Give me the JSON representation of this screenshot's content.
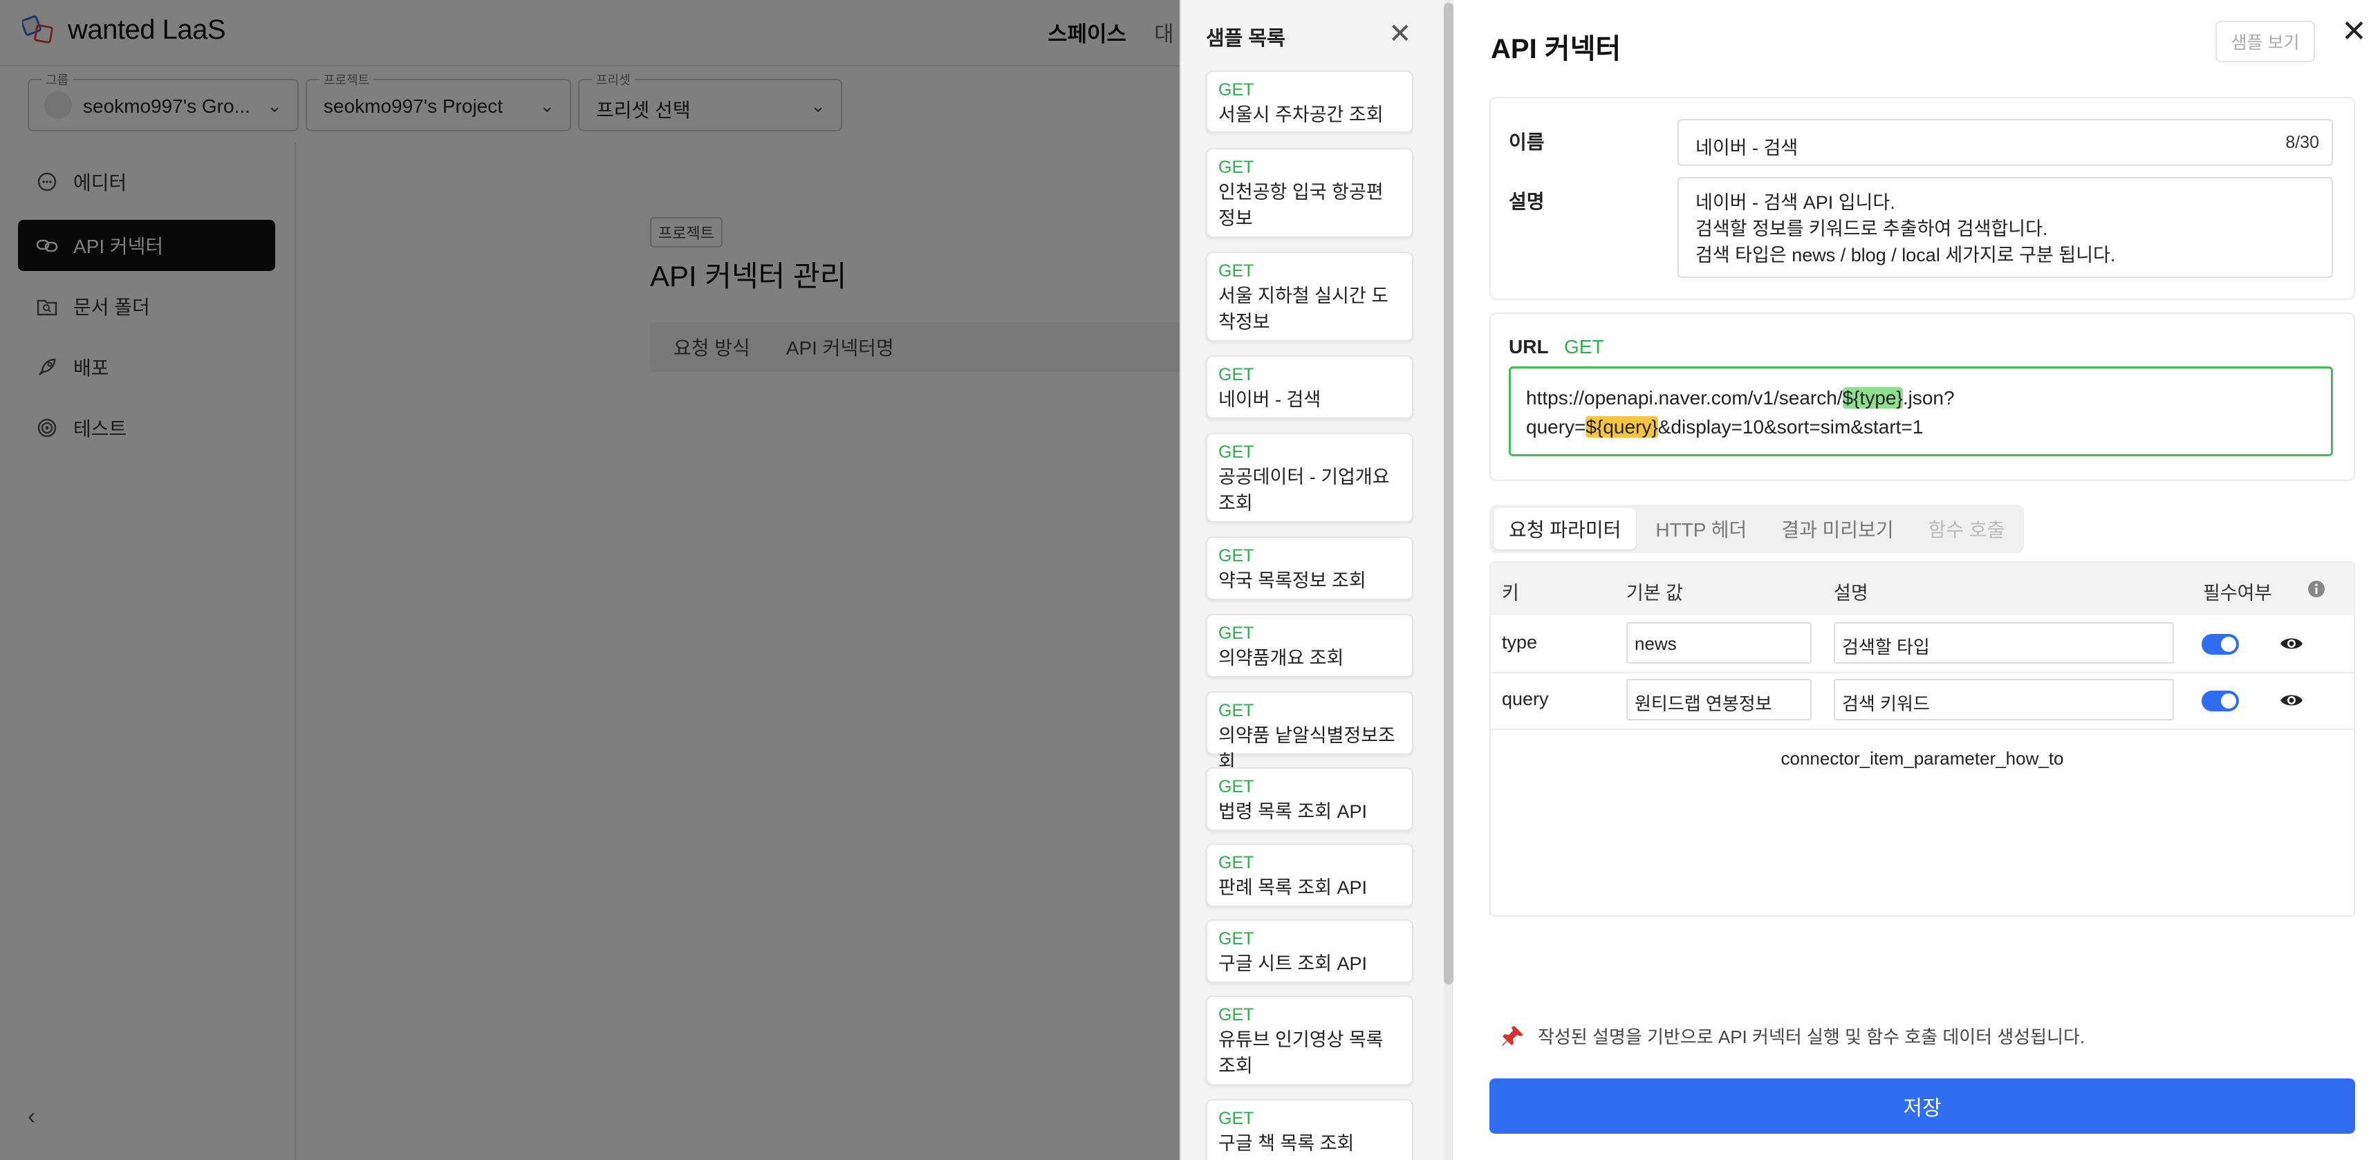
{
  "app": {
    "logo_text": "wanted LaaS",
    "nav": [
      "스페이스",
      "대"
    ],
    "selectors": [
      {
        "label": "그룹",
        "value": "seokmo997's Gro..."
      },
      {
        "label": "프로젝트",
        "value": "seokmo997's Project"
      },
      {
        "label": "프리셋",
        "value": "프리셋 선택"
      }
    ],
    "sidebar": [
      {
        "label": "에디터",
        "icon": "chat-bubble-icon"
      },
      {
        "label": "API 커넥터",
        "icon": "link-icon"
      },
      {
        "label": "문서 폴더",
        "icon": "folder-search-icon"
      },
      {
        "label": "배포",
        "icon": "rocket-icon"
      },
      {
        "label": "테스트",
        "icon": "target-icon"
      }
    ],
    "main": {
      "badge": "프로젝트",
      "title": "API 커넥터 관리",
      "columns": [
        "요청 방식",
        "API 커넥터명"
      ]
    }
  },
  "samples": {
    "title": "샘플 목록",
    "items": [
      {
        "method": "GET",
        "title": "서울시 주차공간 조회"
      },
      {
        "method": "GET",
        "title": "인천공항 입국 항공편 정보"
      },
      {
        "method": "GET",
        "title": "서울 지하철 실시간 도착정보"
      },
      {
        "method": "GET",
        "title": "네이버 - 검색"
      },
      {
        "method": "GET",
        "title": "공공데이터 - 기업개요조회"
      },
      {
        "method": "GET",
        "title": "약국 목록정보 조회"
      },
      {
        "method": "GET",
        "title": "의약품개요 조회"
      },
      {
        "method": "GET",
        "title": "의약품 낱알식별정보조회"
      },
      {
        "method": "GET",
        "title": "법령 목록 조회 API"
      },
      {
        "method": "GET",
        "title": "판례 목록 조회 API"
      },
      {
        "method": "GET",
        "title": "구글 시트 조회 API"
      },
      {
        "method": "GET",
        "title": "유튜브 인기영상 목록 조회"
      },
      {
        "method": "GET",
        "title": "구글 책 목록 조회"
      }
    ]
  },
  "editor": {
    "title": "API 커넥터",
    "sample_view_label": "샘플 보기",
    "name_label": "이름",
    "name_value": "네이버 - 검색",
    "name_count": "8/30",
    "desc_label": "설명",
    "desc_lines": [
      "네이버 - 검색 API 입니다.",
      "검색할 정보를 키워드로 추출하여 검색합니다.",
      "검색 타입은 news / blog / local 세가지로 구분 됩니다."
    ],
    "url_label": "URL",
    "url_method": "GET",
    "url": {
      "part1": "https://openapi.naver.com/v1/search/",
      "var1": "${type}",
      "part2": ".json?",
      "part3": "query=",
      "var2": "${query}",
      "part4": "&display=10&sort=sim&start=1"
    },
    "tabs": [
      "요청 파라미터",
      "HTTP 헤더",
      "결과 미리보기",
      "함수 호출"
    ],
    "param_columns": {
      "key": "키",
      "default": "기본 값",
      "desc": "설명",
      "required": "필수여부"
    },
    "params": [
      {
        "key": "type",
        "default": "news",
        "desc": "검색할 타입",
        "required": true
      },
      {
        "key": "query",
        "default": "원티드랩 연봉정보",
        "desc": "검색 키워드",
        "required": true
      }
    ],
    "howto": "connector_item_parameter_how_to",
    "note": "작성된 설명을 기반으로 API 커넥터 실행 및 함수 호출 데이터 생성됩니다.",
    "save_label": "저장"
  },
  "colors": {
    "accent": "#2f6df2",
    "get_green": "#29b14a",
    "url_border": "#3fbf55",
    "var_green": "#8ee08f",
    "var_yellow": "#f5c542"
  }
}
